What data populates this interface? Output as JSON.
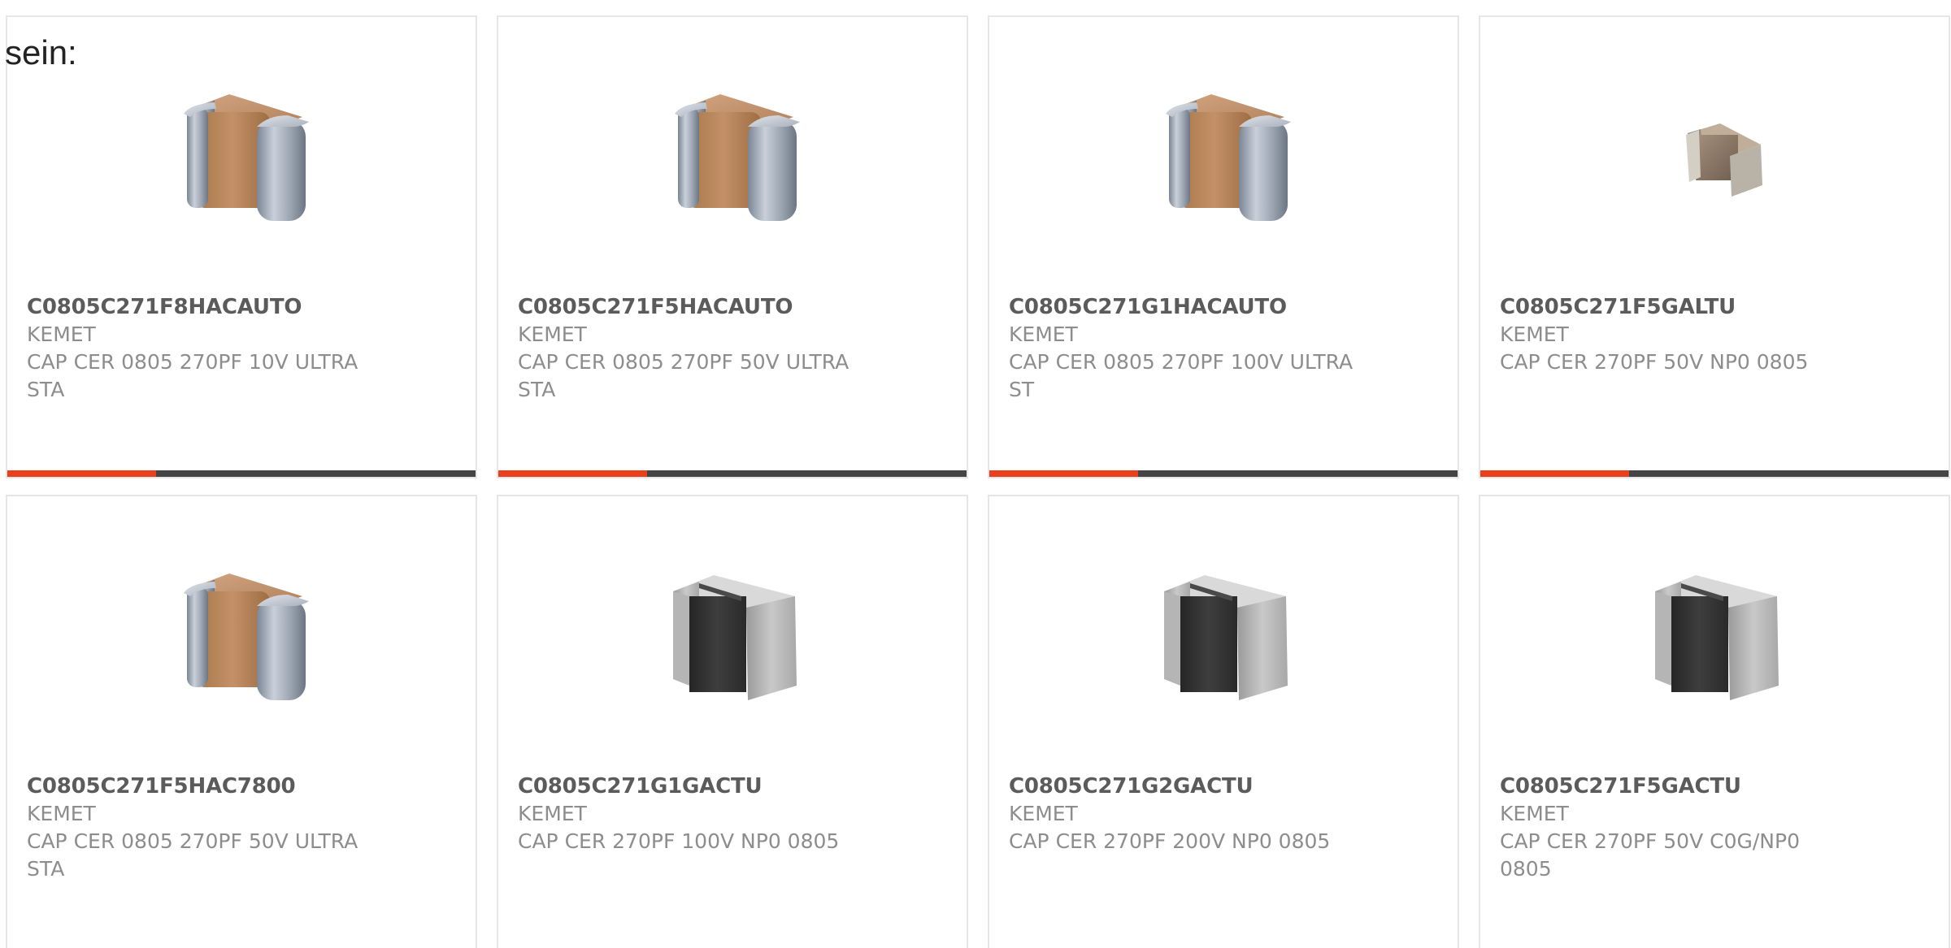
{
  "intro": {
    "text": "sein:"
  },
  "accent_color": "#e8401c",
  "bar_color": "#444444",
  "products": [
    {
      "mpn": "C0805C271F8HACAUTO",
      "manufacturer": "KEMET",
      "description": "CAP CER 0805 270PF 10V ULTRA STA",
      "image": "capacitor-tan-icon"
    },
    {
      "mpn": "C0805C271F5HACAUTO",
      "manufacturer": "KEMET",
      "description": "CAP CER 0805 270PF 50V ULTRA STA",
      "image": "capacitor-tan-icon"
    },
    {
      "mpn": "C0805C271G1HACAUTO",
      "manufacturer": "KEMET",
      "description": "CAP CER 0805 270PF 100V ULTRA ST",
      "image": "capacitor-tan-icon"
    },
    {
      "mpn": "C0805C271F5GALTU",
      "manufacturer": "KEMET",
      "description": "CAP CER 270PF 50V NP0 0805",
      "image": "capacitor-small-icon"
    },
    {
      "mpn": "C0805C271F5HAC7800",
      "manufacturer": "KEMET",
      "description": "CAP CER 0805 270PF 50V ULTRA STA",
      "image": "capacitor-tan-icon"
    },
    {
      "mpn": "C0805C271G1GACTU",
      "manufacturer": "KEMET",
      "description": "CAP CER 270PF 100V NP0 0805",
      "image": "capacitor-dark-icon"
    },
    {
      "mpn": "C0805C271G2GACTU",
      "manufacturer": "KEMET",
      "description": "CAP CER 270PF 200V NP0 0805",
      "image": "capacitor-dark-icon"
    },
    {
      "mpn": "C0805C271F5GACTU",
      "manufacturer": "KEMET",
      "description": "CAP CER 270PF 50V C0G/NP0 0805",
      "image": "capacitor-dark-icon"
    }
  ]
}
